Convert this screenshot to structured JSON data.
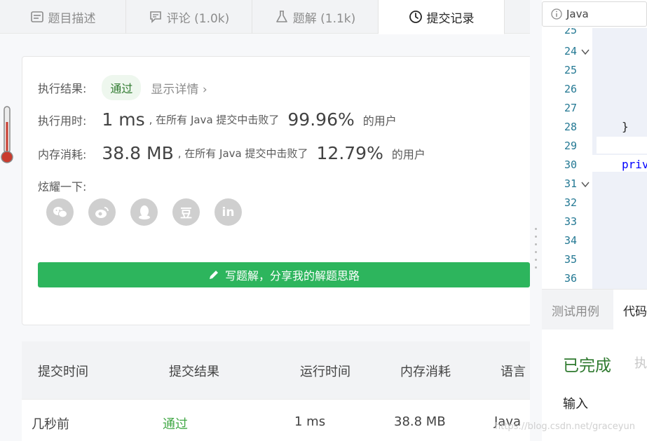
{
  "tabs": [
    {
      "label": "题目描述",
      "icon": "description-icon"
    },
    {
      "label": "评论 (1.0k)",
      "icon": "comment-icon"
    },
    {
      "label": "题解 (1.1k)",
      "icon": "flask-icon"
    },
    {
      "label": "提交记录",
      "icon": "clock-icon"
    }
  ],
  "result": {
    "exec_label": "执行结果:",
    "status": "通过",
    "detail_link": "显示详情",
    "time_label": "执行用时:",
    "time_value": "1 ms",
    "beat_text": ", 在所有 Java 提交中击败了",
    "time_pct": "99.96%",
    "users_suffix": "的用户",
    "mem_label": "内存消耗:",
    "mem_value": "38.8 MB",
    "mem_pct": "12.79%",
    "share_label": "炫耀一下:",
    "write_button": "写题解，分享我的解题思路"
  },
  "share_icons": [
    "wechat-icon",
    "weibo-icon",
    "qq-icon",
    "douban-icon",
    "linkedin-icon"
  ],
  "share_glyphs": {
    "douban": "豆",
    "linkedin": "in"
  },
  "table": {
    "headers": [
      "提交时间",
      "提交结果",
      "运行时间",
      "内存消耗",
      "语言"
    ],
    "rows": [
      {
        "time": "几秒前",
        "result": "通过",
        "runtime": "1 ms",
        "memory": "38.8 MB",
        "lang": "Java"
      }
    ]
  },
  "editor": {
    "language": "Java",
    "line_numbers": [
      "25",
      "24",
      "25",
      "26",
      "27",
      "28",
      "29",
      "30",
      "31",
      "32",
      "33",
      "34",
      "35",
      "36"
    ],
    "code_brace": "}",
    "code_private": "priv"
  },
  "console": {
    "tab_testcase": "测试用例",
    "tab_code": "代码",
    "status": "已完成",
    "faded": "执",
    "input_label": "输入"
  },
  "watermark": "https://blog.csdn.net/graceyun",
  "colors": {
    "accent_green": "#2db55d",
    "pass_green": "#42a846",
    "line_number": "#237893"
  }
}
